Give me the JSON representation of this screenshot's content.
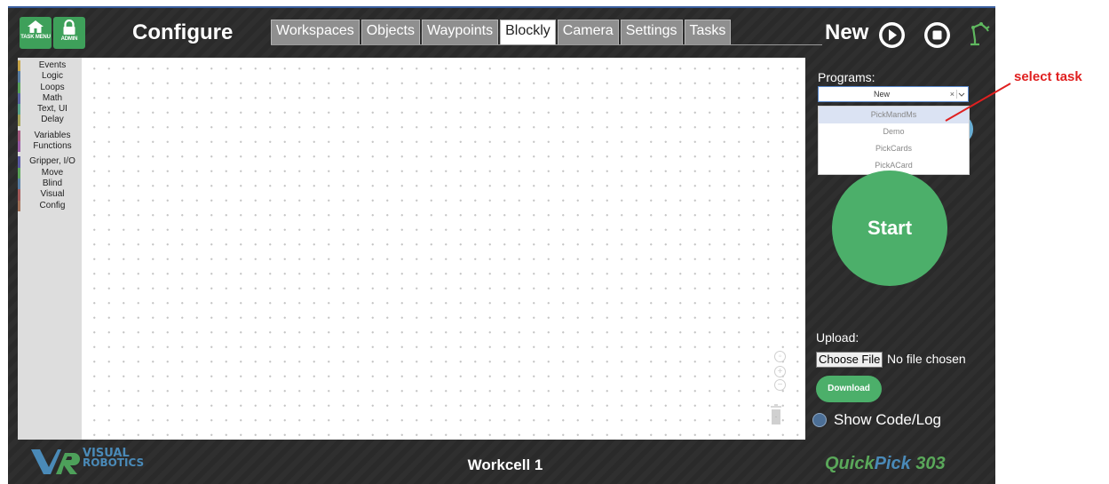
{
  "header": {
    "task_menu_label": "TASK MENU",
    "admin_label": "ADMIN",
    "title": "Configure",
    "tabs": [
      "Workspaces",
      "Objects",
      "Waypoints",
      "Blockly",
      "Camera",
      "Settings",
      "Tasks"
    ],
    "active_tab": "Blockly",
    "program_name": "New"
  },
  "toolbox": {
    "categories": [
      {
        "label": "Events",
        "color": "#c8a64a"
      },
      {
        "label": "Logic",
        "color": "#5b80a5"
      },
      {
        "label": "Loops",
        "color": "#5ba55b"
      },
      {
        "label": "Math",
        "color": "#5b67a5"
      },
      {
        "label": "Text, UI",
        "color": "#5ba58c"
      },
      {
        "label": "Delay",
        "color": "#a5a55b"
      },
      {
        "label": "Variables",
        "color": "#a55b80"
      },
      {
        "label": "Functions",
        "color": "#995ba5"
      },
      {
        "label": "Gripper, I/O",
        "color": "#5b5ba5"
      },
      {
        "label": "Move",
        "color": "#5ba55b"
      },
      {
        "label": "Blind",
        "color": "#5b80a5"
      },
      {
        "label": "Visual",
        "color": "#a55b5b"
      },
      {
        "label": "Config",
        "color": "#a5745b"
      }
    ]
  },
  "sidebar": {
    "programs_label": "Programs:",
    "selected_program": "New",
    "clear_symbol": "×",
    "options": [
      "PickMandMs",
      "Demo",
      "PickCards",
      "PickACard"
    ],
    "start_label": "Start",
    "upload_label": "Upload:",
    "choose_file_label": "Choose File",
    "no_file_text": "No file chosen",
    "download_label": "Download",
    "show_code_label": "Show Code/Log"
  },
  "footer": {
    "logo_line1": "VISUAL",
    "logo_line2": "ROBOTICS",
    "workcell": "Workcell 1",
    "brand_quick": "Quick",
    "brand_pick": "Pick",
    "brand_number": " 303"
  },
  "annotation": {
    "text": "select task"
  },
  "colors": {
    "accent_green": "#4caf6a",
    "background": "#2a2a2a",
    "brand_green": "#5aa85a",
    "brand_blue": "#4a8ab8",
    "annotation_red": "#e02020"
  }
}
